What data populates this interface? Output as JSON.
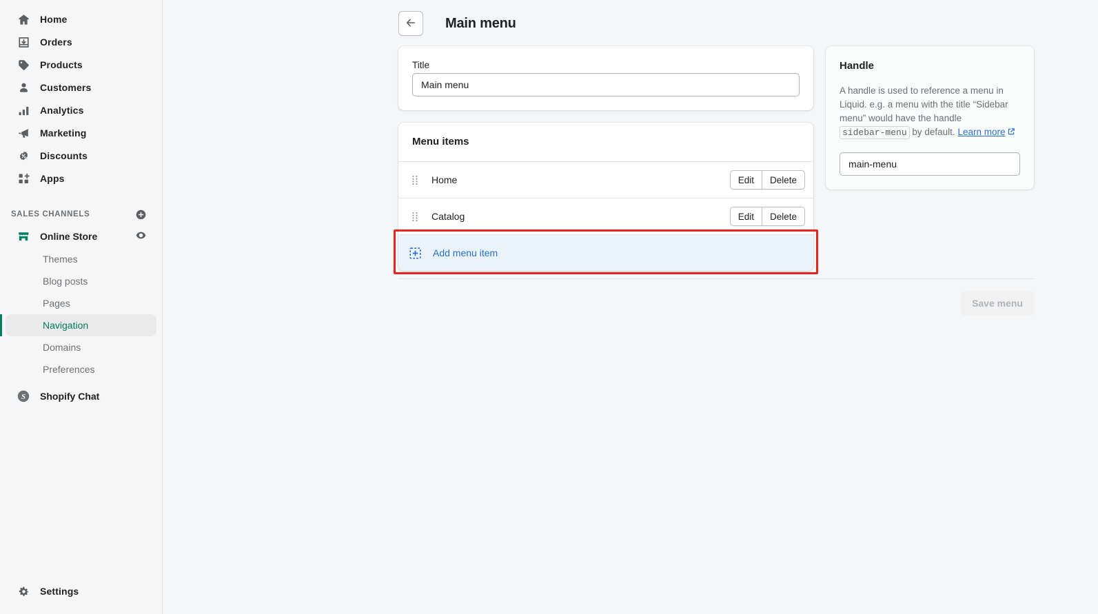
{
  "sidebar": {
    "primary_items": [
      {
        "label": "Home",
        "icon": "home-icon"
      },
      {
        "label": "Orders",
        "icon": "orders-icon"
      },
      {
        "label": "Products",
        "icon": "products-tag-icon"
      },
      {
        "label": "Customers",
        "icon": "customers-person-icon"
      },
      {
        "label": "Analytics",
        "icon": "analytics-bars-icon"
      },
      {
        "label": "Marketing",
        "icon": "marketing-megaphone-icon"
      },
      {
        "label": "Discounts",
        "icon": "discounts-badge-icon"
      },
      {
        "label": "Apps",
        "icon": "apps-grid-plus-icon"
      }
    ],
    "section_title": "SALES CHANNELS",
    "add_channel_icon": "plus-circle-icon",
    "channel": {
      "label": "Online Store",
      "icon": "storefront-icon",
      "view_icon": "eye-icon"
    },
    "sub_items": [
      {
        "label": "Themes",
        "active": false
      },
      {
        "label": "Blog posts",
        "active": false
      },
      {
        "label": "Pages",
        "active": false
      },
      {
        "label": "Navigation",
        "active": true
      },
      {
        "label": "Domains",
        "active": false
      },
      {
        "label": "Preferences",
        "active": false
      }
    ],
    "chat": {
      "label": "Shopify Chat",
      "icon": "shopify-chat-icon"
    },
    "settings": {
      "label": "Settings",
      "icon": "gear-icon"
    },
    "accent_color": "#008060",
    "active_text_color": "#007b5c"
  },
  "header": {
    "back_icon": "arrow-left-icon",
    "title": "Main menu"
  },
  "title_card": {
    "label": "Title",
    "value": "Main menu",
    "placeholder": "Main menu"
  },
  "menu_items_card": {
    "title": "Menu items",
    "rows": [
      {
        "name": "Home",
        "drag_icon": "drag-handle-icon",
        "edit_label": "Edit",
        "delete_label": "Delete"
      },
      {
        "name": "Catalog",
        "drag_icon": "drag-handle-icon",
        "edit_label": "Edit",
        "delete_label": "Delete"
      }
    ],
    "add_row": {
      "label": "Add menu item",
      "icon": "add-square-plus-icon",
      "highlighted": true,
      "highlight_color": "#e8241d",
      "background_color": "#eaf2fb",
      "text_color": "#2c6ecb"
    }
  },
  "handle_panel": {
    "title": "Handle",
    "description_part1": "A handle is used to reference a menu in Liquid. e.g. a menu with the title “Sidebar menu” would have the handle",
    "code_value": "sidebar-menu",
    "description_part2": "by default.",
    "learn_more_label": "Learn more",
    "external_link_icon": "external-link-icon",
    "value": "main-menu",
    "placeholder": "main-menu"
  },
  "footer": {
    "save_label": "Save menu",
    "save_disabled": true
  }
}
